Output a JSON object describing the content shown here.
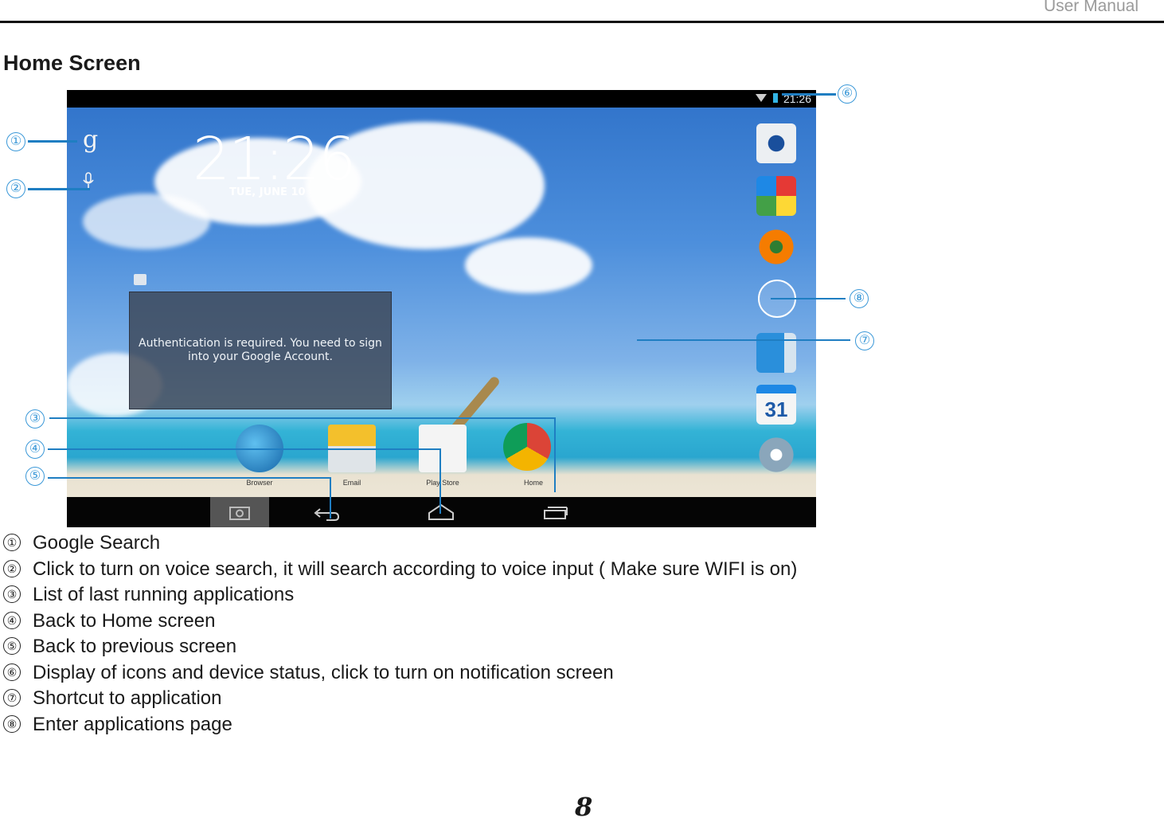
{
  "header": {
    "manual_label": "User Manual"
  },
  "page": {
    "title": "Home Screen",
    "page_number": "8"
  },
  "screen": {
    "status_time": "21:26",
    "clock": "21:26",
    "date": "TUE, JUNE 10",
    "widget_message": "Authentication is required. You need to sign into your Google Account.",
    "dock_apps": [
      "Browser",
      "Email",
      "Play Store",
      "Home"
    ],
    "side_icons": [
      "camera-icon",
      "gallery-icon",
      "music-icon",
      "all-apps-icon",
      "contacts-icon",
      "calendar-icon",
      "settings-icon"
    ],
    "calendar_day": "31"
  },
  "callouts": [
    "①",
    "②",
    "③",
    "④",
    "⑤",
    "⑥",
    "⑦",
    "⑧"
  ],
  "legend": [
    {
      "num": "①",
      "text": "Google Search"
    },
    {
      "num": "②",
      "text": "Click to turn on voice search, it will search according to voice input ( Make sure WIFI is on)"
    },
    {
      "num": "③",
      "text": "List of last running applications"
    },
    {
      "num": "④",
      "text": "Back to Home screen"
    },
    {
      "num": "⑤",
      "text": "Back to previous screen"
    },
    {
      "num": "⑥",
      "text": "Display of icons and device status, click to turn on notification screen"
    },
    {
      "num": "⑦",
      "text": "Shortcut to application"
    },
    {
      "num": "⑧",
      "text": "Enter applications page"
    }
  ]
}
